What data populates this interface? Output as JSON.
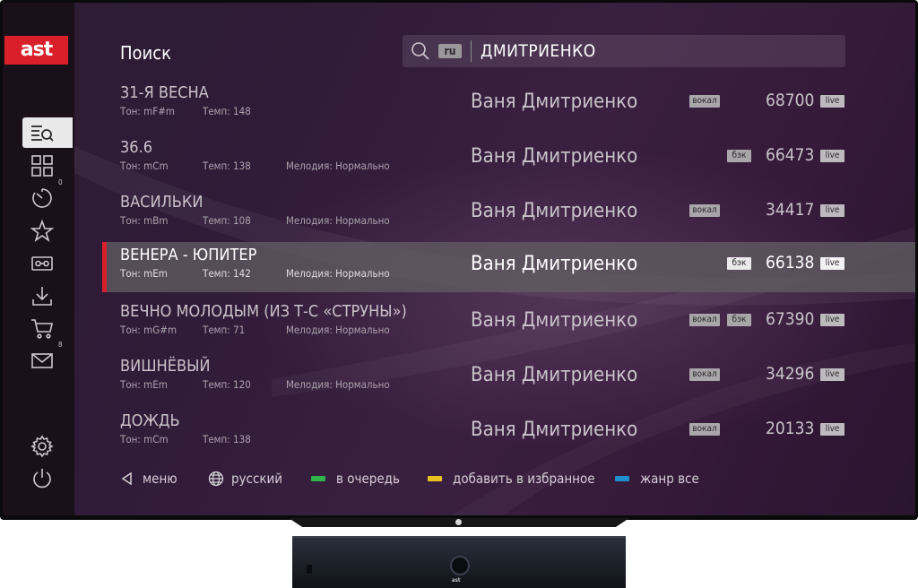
{
  "brand": {
    "logo_text": "ast",
    "color": "#d9202a"
  },
  "page": {
    "title": "Поиск"
  },
  "search": {
    "icon": "search-icon",
    "lang": "ru",
    "query": "ДМИТРИЕНКО"
  },
  "sidebar": {
    "items": [
      {
        "name": "search-list",
        "icon": "search-list-icon",
        "active": true
      },
      {
        "name": "catalog",
        "icon": "grid-icon"
      },
      {
        "name": "history",
        "icon": "timer-icon",
        "badge": "0"
      },
      {
        "name": "favorites",
        "icon": "star-icon"
      },
      {
        "name": "recordings",
        "icon": "cassette-icon"
      },
      {
        "name": "downloads",
        "icon": "download-icon"
      },
      {
        "name": "cart",
        "icon": "cart-icon"
      },
      {
        "name": "messages",
        "icon": "mail-icon",
        "badge": "8"
      },
      {
        "name": "settings",
        "icon": "gear-icon"
      },
      {
        "name": "power",
        "icon": "power-icon"
      }
    ]
  },
  "results": [
    {
      "title": "31-Я ВЕСНА",
      "tone": "Тон: mF#m",
      "tempo": "Темп: 148",
      "melody": "",
      "artist": "Ваня Дмитриенко",
      "vocal": "вокал",
      "back": "",
      "number": "68700",
      "live": "live",
      "selected": false
    },
    {
      "title": "36.6",
      "tone": "Тон: mCm",
      "tempo": "Темп: 138",
      "melody": "Мелодия: Нормально",
      "artist": "Ваня Дмитриенко",
      "vocal": "",
      "back": "бэк",
      "number": "66473",
      "live": "live",
      "selected": false
    },
    {
      "title": "ВАСИЛЬКИ",
      "tone": "Тон: mBm",
      "tempo": "Темп: 108",
      "melody": "Мелодия: Нормально",
      "artist": "Ваня Дмитриенко",
      "vocal": "вокал",
      "back": "",
      "number": "34417",
      "live": "live",
      "selected": false
    },
    {
      "title": "ВЕНЕРА - ЮПИТЕР",
      "tone": "Тон: mEm",
      "tempo": "Темп: 142",
      "melody": "Мелодия: Нормально",
      "artist": "Ваня Дмитриенко",
      "vocal": "",
      "back": "бэк",
      "number": "66138",
      "live": "live",
      "selected": true
    },
    {
      "title": "ВЕЧНО МОЛОДЫМ (ИЗ Т-С «СТРУНЫ»)",
      "tone": "Тон: mG#m",
      "tempo": "Темп: 71",
      "melody": "Мелодия: Нормально",
      "artist": "Ваня Дмитриенко",
      "vocal": "вокал",
      "back": "бэк",
      "number": "67390",
      "live": "live",
      "selected": false
    },
    {
      "title": "ВИШНЁВЫЙ",
      "tone": "Тон: mEm",
      "tempo": "Темп: 120",
      "melody": "Мелодия: Нормально",
      "artist": "Ваня Дмитриенко",
      "vocal": "вокал",
      "back": "",
      "number": "34296",
      "live": "live",
      "selected": false
    },
    {
      "title": "ДОЖДЬ",
      "tone": "Тон: mCm",
      "tempo": "Темп: 138",
      "melody": "",
      "artist": "Ваня Дмитриенко",
      "vocal": "вокал",
      "back": "",
      "number": "20133",
      "live": "live",
      "selected": false
    }
  ],
  "footer": {
    "menu": {
      "icon": "back-arrow-icon",
      "label": "меню"
    },
    "language": {
      "icon": "globe-icon",
      "label": "русский"
    },
    "queue": {
      "color": "#2fb34a",
      "label": "в очередь"
    },
    "favorite": {
      "color": "#e8c21e",
      "label": "добавить в избранное"
    },
    "genre": {
      "color": "#1f8fce",
      "label": "жанр все"
    }
  },
  "hardware": {
    "box_logo": "ast"
  }
}
